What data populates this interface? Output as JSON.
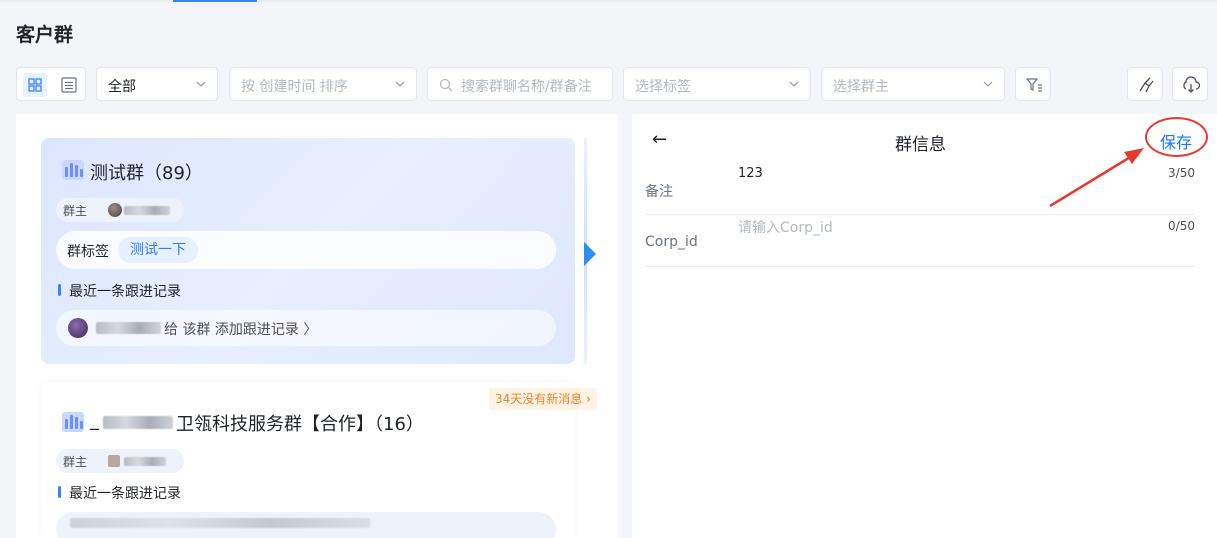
{
  "page": {
    "title": "客户群"
  },
  "toolbar": {
    "filter_all": "全部",
    "sort_placeholder": "按 创建时间 排序",
    "search_placeholder": "搜索群聊名称/群备注",
    "tag_placeholder": "选择标签",
    "owner_placeholder": "选择群主"
  },
  "groups": [
    {
      "name": "测试群（89）",
      "owner_label": "群主",
      "tag_label": "群标签",
      "tag": "测试一下",
      "recent_label": "最近一条跟进记录",
      "follow_text": "给 该群 添加跟进记录 〉"
    },
    {
      "name_prefix": "_",
      "name_suffix": "卫瓴科技服务群【合作】（16）",
      "owner_label": "群主",
      "recent_label": "最近一条跟进记录",
      "badge": "34天没有新消息 ›"
    }
  ],
  "detail": {
    "back": "←",
    "title": "群信息",
    "save": "保存",
    "fields": [
      {
        "label": "备注",
        "value": "123",
        "count": "3/50"
      },
      {
        "label": "Corp_id",
        "placeholder": "请输入Corp_id",
        "count": "0/50"
      }
    ]
  },
  "colors": {
    "accent": "#1677ff",
    "annotation": "#e53935"
  }
}
